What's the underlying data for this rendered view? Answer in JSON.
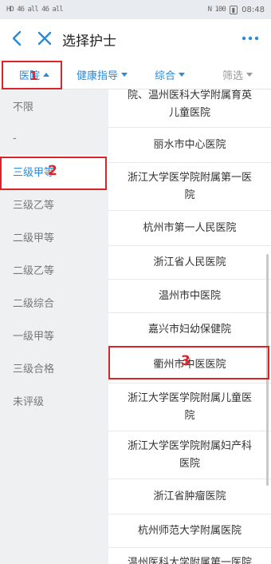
{
  "status_bar": {
    "left_text": "HD 46 all 46 all",
    "right_text": "N 100",
    "time": "08:48"
  },
  "nav": {
    "title": "选择护士",
    "back_icon": "chevron-left-icon",
    "close_icon": "close-icon",
    "more_icon": "more-dots-icon"
  },
  "filters": [
    {
      "label": "医院",
      "state": "active"
    },
    {
      "label": "健康指导",
      "state": "normal"
    },
    {
      "label": "综合",
      "state": "normal"
    },
    {
      "label": "筛选",
      "state": "disabled"
    }
  ],
  "sidebar": {
    "items": [
      "不限",
      "-",
      "三级甲等",
      "三级乙等",
      "二级甲等",
      "二级乙等",
      "二级综合",
      "一级甲等",
      "三级合格",
      "未评级"
    ],
    "selected_index": 2
  },
  "hospitals": [
    "院、温州医科大学附属育英儿童医院",
    "丽水市中心医院",
    "浙江大学医学院附属第一医院",
    "杭州市第一人民医院",
    "浙江省人民医院",
    "温州市中医院",
    "嘉兴市妇幼保健院",
    "衢州市中医医院",
    "浙江大学医学院附属儿童医院",
    "浙江大学医学院附属妇产科医院",
    "浙江省肿瘤医院",
    "杭州师范大学附属医院",
    "温州医科大学附属第一医院"
  ],
  "annotations": [
    "1",
    "2",
    "3"
  ],
  "colors": {
    "accent": "#2a8ad6",
    "annotation": "#d9242a",
    "sidebar_bg": "#eef0f2"
  }
}
